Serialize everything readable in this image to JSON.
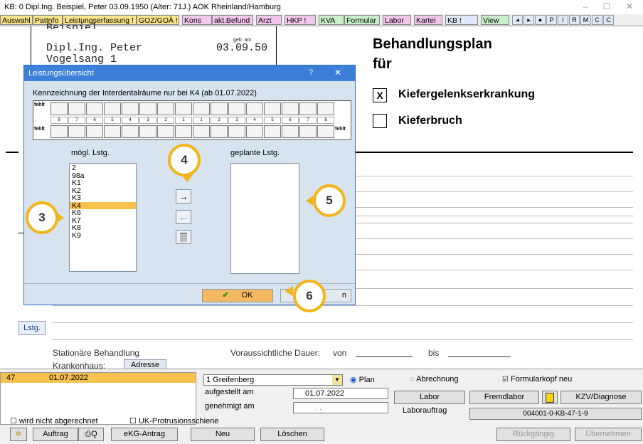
{
  "window": {
    "title": "KB: 0  Dipl.Ing. Beispiel, Peter  03.09.1950 (Alter: 71J.)  AOK Rheinland/Hamburg",
    "min": "–",
    "max": "☐",
    "close": "✕"
  },
  "tabs": [
    {
      "label": "Auswahl",
      "color": "#f6e58a"
    },
    {
      "label": "PatInfo",
      "color": "#f6e58a"
    },
    {
      "label": "Leistungserfassung !",
      "color": "#f6e58a"
    },
    {
      "label": "GOZ/GOÄ !",
      "color": "#f6e58a"
    },
    {
      "label": "Kons",
      "color": "#f2c7ec"
    },
    {
      "label": "akt.Befund",
      "color": "#f2c7ec"
    },
    {
      "label": "Arzt",
      "color": "#f2c7ec"
    },
    {
      "label": "HKP !",
      "color": "#f2c7ec"
    },
    {
      "label": "KVA",
      "color": "#c9f0c9"
    },
    {
      "label": "Formular",
      "color": "#c9f0c9"
    },
    {
      "label": "Labor",
      "color": "#f2c7ec"
    },
    {
      "label": "Kartei",
      "color": "#f2c7ec"
    },
    {
      "label": "KB !",
      "color": "#dfe9f7"
    },
    {
      "label": "View",
      "color": "#c9f0c9"
    }
  ],
  "tab_icons": [
    "◂",
    "▸",
    "●",
    "P",
    "I",
    "R",
    "M",
    "C",
    "C"
  ],
  "document": {
    "name_cut": "Beispiel",
    "name": "Dipl.Ing. Peter",
    "street": "Vogelsang 1",
    "dob_label": "geb. am",
    "dob": "03.09.50",
    "heading1": "Behandlungsplan",
    "heading2": "für",
    "check1_mark": "X",
    "check1_label": "Kiefergelenkserkrankung",
    "check2_mark": "",
    "check2_label": "Kieferbruch",
    "lstg_btn": "Lstg.",
    "stationaer": "Stationäre Behandlung",
    "krankenhaus": "Krankenhaus:",
    "adresse": "Adresse",
    "dauer": "Voraussichtliche Dauer:",
    "von": "von",
    "bis": "bis"
  },
  "dialog": {
    "title": "Leistungsübersicht",
    "help": "?",
    "close": "✕",
    "info": "Kennzeichnung der Interdentalräume nur bei K4 (ab 01.07.2022)",
    "fehlt": "fehlt",
    "upper_numbers": [
      "8",
      "7",
      "6",
      "5",
      "4",
      "3",
      "2",
      "1",
      "1",
      "2",
      "3",
      "4",
      "5",
      "6",
      "7",
      "8"
    ],
    "possible_label": "mögl. Lstg.",
    "planned_label": "geplante Lstg.",
    "possible": [
      "2",
      "98a",
      "K1",
      "K2",
      "K3",
      "K4",
      "K6",
      "K7",
      "K8",
      "K9"
    ],
    "selected_index": 5,
    "planned": [],
    "arrow_right": "→",
    "arrow_left": "←",
    "ok": "OK",
    "cancel_cut": "n"
  },
  "callouts": [
    "3",
    "4",
    "5",
    "6"
  ],
  "bottom": {
    "entry_num": "47",
    "entry_date": "01.07.2022",
    "location": "1 Greifenberg",
    "plan": "Plan",
    "abrechnung": "Abrechnung",
    "formularkopf": "Formularkopf neu",
    "aufgestellt": "aufgestellt am",
    "aufgestellt_val": "01.07.2022",
    "genehmigt": "genehmigt am",
    "genehmigt_val": ". .",
    "labor": "Labor",
    "fremdlabor": "Fremdlabor",
    "kzv": "KZV/Diagnose",
    "laborauftrag": "Laborauftrag",
    "laborauftrag_val": "004001-0-KB-47-1-9",
    "wird_nicht": "wird nicht abgerechnet",
    "uk_prot": "UK-Protrusionsschiene",
    "auftrag": "Auftrag",
    "ekg": "eKG-Antrag",
    "neu": "Neu",
    "loeschen": "Löschen",
    "rueckgaengig": "Rückgängig",
    "uebernehmen": "Übernehmen"
  }
}
